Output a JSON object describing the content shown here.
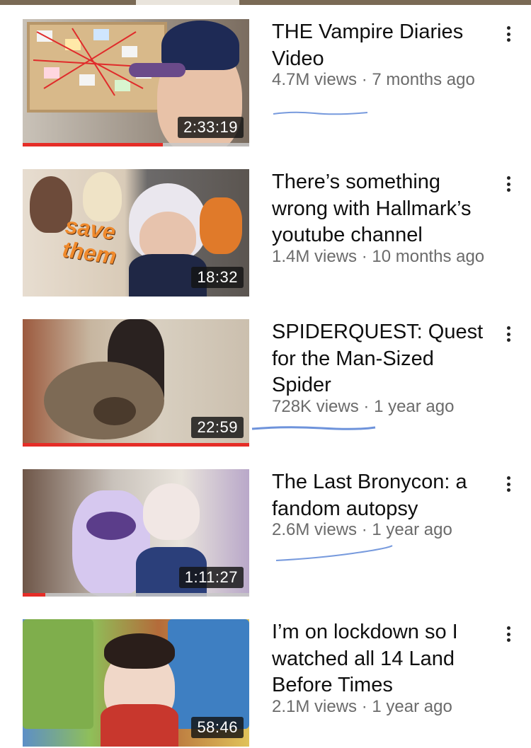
{
  "colors": {
    "progress": "#e52d27",
    "meta_text": "#6b6b6b",
    "title_text": "#0f0f0f",
    "scribble": "#3d6fcf"
  },
  "videos": [
    {
      "title": "THE Vampire Diaries Video",
      "views": "4.7M views",
      "age": "7 months ago",
      "duration": "2:33:19",
      "watched": 0.62,
      "menu_icon": "more-vert-icon"
    },
    {
      "title": "There’s something wrong with Hallmark’s youtube channel",
      "views": "1.4M views",
      "age": "10 months ago",
      "duration": "18:32",
      "thumb_text": [
        "save",
        "them"
      ],
      "menu_icon": "more-vert-icon"
    },
    {
      "title": "SPIDERQUEST: Quest for the Man-Sized Spider",
      "views": "728K views",
      "age": "1 year ago",
      "duration": "22:59",
      "watched": 1.0,
      "menu_icon": "more-vert-icon"
    },
    {
      "title": "The Last Bronycon: a fandom autopsy",
      "views": "2.6M views",
      "age": "1 year ago",
      "duration": "1:11:27",
      "watched": 0.1,
      "menu_icon": "more-vert-icon"
    },
    {
      "title": "I’m on lockdown so I watched all 14 Land Before Times",
      "views": "2.1M views",
      "age": "1 year ago",
      "duration": "58:46",
      "menu_icon": "more-vert-icon"
    }
  ],
  "separator": " · "
}
